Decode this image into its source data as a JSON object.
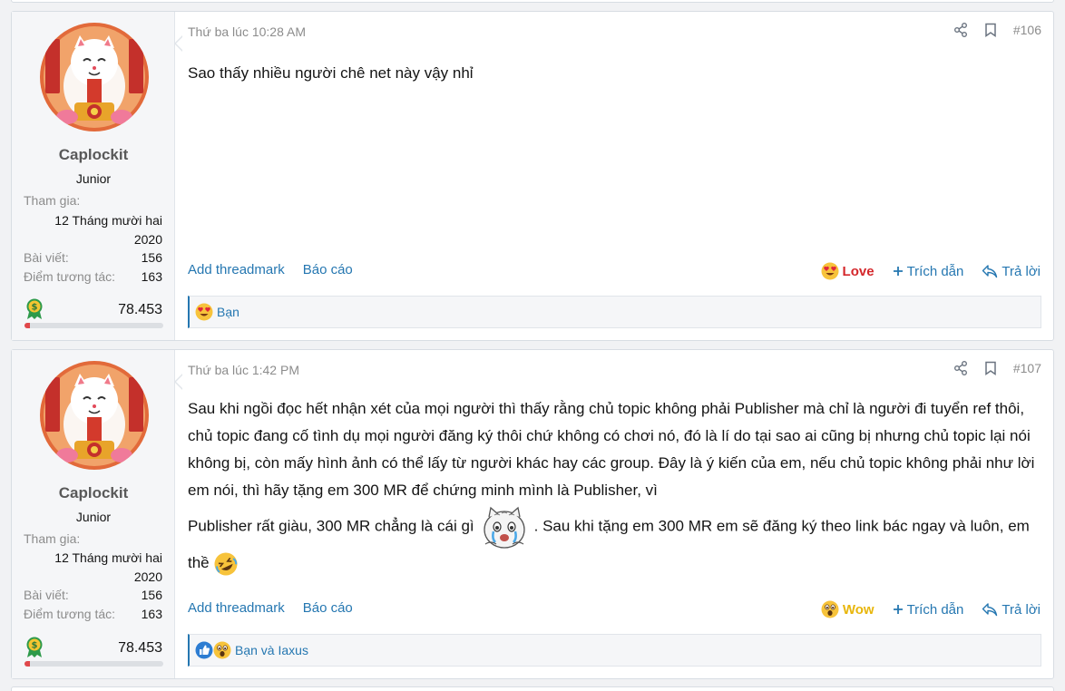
{
  "posts": [
    {
      "user": {
        "name": "Caplockit",
        "title": "Junior",
        "joined_label": "Tham gia:",
        "joined_value_line1": "12 Tháng mười hai",
        "joined_value_line2": "2020",
        "posts_label": "Bài viết:",
        "posts_value": "156",
        "reaction_label": "Điểm tương tác:",
        "reaction_value": "163",
        "points": "78.453"
      },
      "time": "Thứ ba lúc 10:28 AM",
      "number": "#106",
      "body": "Sao thấy nhiều người chê net này vậy nhỉ",
      "actions": {
        "threadmark": "Add threadmark",
        "report": "Báo cáo",
        "reaction": "Love",
        "quote": "Trích dẫn",
        "reply": "Trả lời"
      },
      "reacted_by": "Bạn"
    },
    {
      "user": {
        "name": "Caplockit",
        "title": "Junior",
        "joined_label": "Tham gia:",
        "joined_value_line1": "12 Tháng mười hai",
        "joined_value_line2": "2020",
        "posts_label": "Bài viết:",
        "posts_value": "156",
        "reaction_label": "Điểm tương tác:",
        "reaction_value": "163",
        "points": "78.453"
      },
      "time": "Thứ ba lúc 1:42 PM",
      "number": "#107",
      "body_part1": "Sau khi ngồi đọc hết nhận xét của mọi người thì thấy rằng chủ topic không phải Publisher mà chỉ là người đi tuyển ref thôi, chủ topic đang cố tình dụ mọi người đăng ký thôi chứ không có chơi nó, đó là lí do tại sao ai cũng bị nhưng chủ topic lại nói không bị, còn mấy hình ảnh có thể lấy từ người khác hay các group. Đây là ý kiến của em, nếu chủ topic không phải như lời em nói, thì hãy tặng em 300 MR để chứng minh mình là Publisher, vì",
      "body_part2": "Publisher rất giàu, 300 MR chẳng là cái gì",
      "body_part3": ". Sau khi tặng em 300 MR em sẽ đăng ký theo link bác ngay và luôn, em thề",
      "actions": {
        "threadmark": "Add threadmark",
        "report": "Báo cáo",
        "reaction": "Wow",
        "quote": "Trích dẫn",
        "reply": "Trả lời"
      },
      "reacted_by": "Bạn và Iaxus"
    }
  ],
  "colors": {
    "link": "#2577b1",
    "love": "#d4272b",
    "wow": "#e8b60c",
    "muted": "#8c8c8c"
  },
  "icons": [
    "share-icon",
    "bookmark-icon",
    "plus-icon",
    "reply-icon",
    "love-emoji-icon",
    "wow-emoji-icon",
    "like-emoji-icon",
    "dollar-medal-icon"
  ]
}
